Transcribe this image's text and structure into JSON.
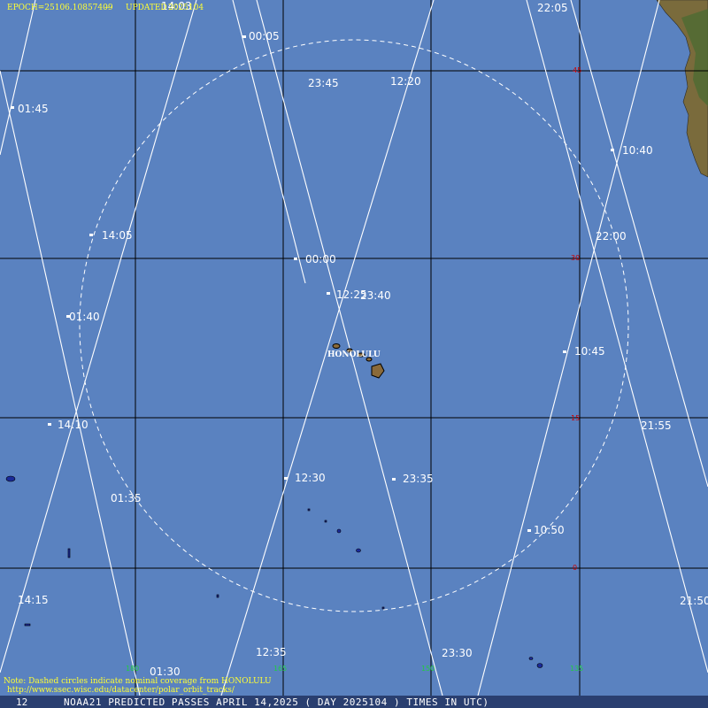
{
  "header": {
    "epoch": "EPOCH=25106.10857409",
    "separator": "---",
    "updated": "UPDATED",
    "updated_value": "2025104"
  },
  "footer": {
    "page_number": "12",
    "title": "NOAA21 PREDICTED PASSES APRIL 14,2025 ( DAY 2025104 ) TIMES IN UTC)",
    "note": "Note: Dashed circles indicate nominal coverage from HONOLULU",
    "url": "http://www.ssec.wisc.edu/datacenter/polar_orbit_tracks/"
  },
  "station": {
    "name": "HONOLULU"
  },
  "grid": {
    "lat_labels": [
      "45",
      "30",
      "15",
      "0"
    ],
    "lon_labels": [
      "180",
      "165",
      "150",
      "135"
    ]
  },
  "pass_times": [
    "14:03",
    "00:05",
    "23:45",
    "12:20",
    "22:05",
    "01:45",
    "10:40",
    "14:05",
    "22:00",
    "00:00",
    "12:25",
    "23:40",
    "01:40",
    "10:45",
    "14:10",
    "21:55",
    "12:30",
    "23:35",
    "01:35",
    "10:50",
    "14:15",
    "21:50",
    "12:35",
    "23:30",
    "01:30"
  ],
  "colors": {
    "ocean": "#5a82c0",
    "grid_line": "#000000",
    "track": "#ffffff",
    "lat_label": "#cc0000",
    "lon_label": "#22cc44",
    "header_text": "#ffff33",
    "footer_bar": "#2a3f70",
    "land": "#8a6a3a",
    "vegetation": "#4d6b32"
  }
}
